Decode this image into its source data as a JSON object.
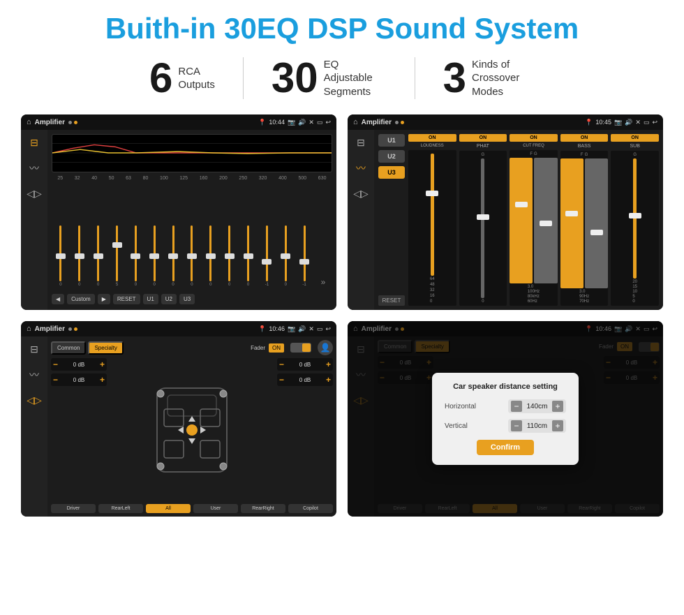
{
  "title": "Buith-in 30EQ DSP Sound System",
  "stats": [
    {
      "number": "6",
      "label": "RCA\nOutputs"
    },
    {
      "number": "30",
      "label": "EQ Adjustable\nSegments"
    },
    {
      "number": "3",
      "label": "Kinds of\nCrossover Modes"
    }
  ],
  "screens": [
    {
      "id": "screen1",
      "app_name": "Amplifier",
      "time": "10:44",
      "type": "eq"
    },
    {
      "id": "screen2",
      "app_name": "Amplifier",
      "time": "10:45",
      "type": "crossover"
    },
    {
      "id": "screen3",
      "app_name": "Amplifier",
      "time": "10:46",
      "type": "fader"
    },
    {
      "id": "screen4",
      "app_name": "Amplifier",
      "time": "10:46",
      "type": "fader-dialog"
    }
  ],
  "eq_screen": {
    "frequencies": [
      "25",
      "32",
      "40",
      "50",
      "63",
      "80",
      "100",
      "125",
      "160",
      "200",
      "250",
      "320",
      "400",
      "500",
      "630"
    ],
    "values": [
      "0",
      "0",
      "0",
      "5",
      "0",
      "0",
      "0",
      "0",
      "0",
      "0",
      "0",
      "-1",
      "0",
      "-1",
      ""
    ],
    "preset": "Custom",
    "buttons": [
      "RESET",
      "U1",
      "U2",
      "U3"
    ]
  },
  "crossover_screen": {
    "units": [
      "U1",
      "U2",
      "U3"
    ],
    "channels": [
      {
        "label": "LOUDNESS",
        "on": true
      },
      {
        "label": "PHAT",
        "on": true
      },
      {
        "label": "CUT FREQ",
        "on": true
      },
      {
        "label": "BASS",
        "on": true
      },
      {
        "label": "SUB",
        "on": true
      }
    ]
  },
  "fader_screen": {
    "modes": [
      "Common",
      "Specialty"
    ],
    "active_mode": "Specialty",
    "fader_label": "Fader",
    "fader_on": "ON",
    "db_values": [
      "0 dB",
      "0 dB",
      "0 dB",
      "0 dB"
    ],
    "bottom_btns": [
      "Driver",
      "RearLeft",
      "All",
      "User",
      "RearRight",
      "Copilot"
    ]
  },
  "dialog": {
    "title": "Car speaker distance setting",
    "horizontal_label": "Horizontal",
    "horizontal_value": "140cm",
    "vertical_label": "Vertical",
    "vertical_value": "110cm",
    "confirm_btn": "Confirm"
  }
}
